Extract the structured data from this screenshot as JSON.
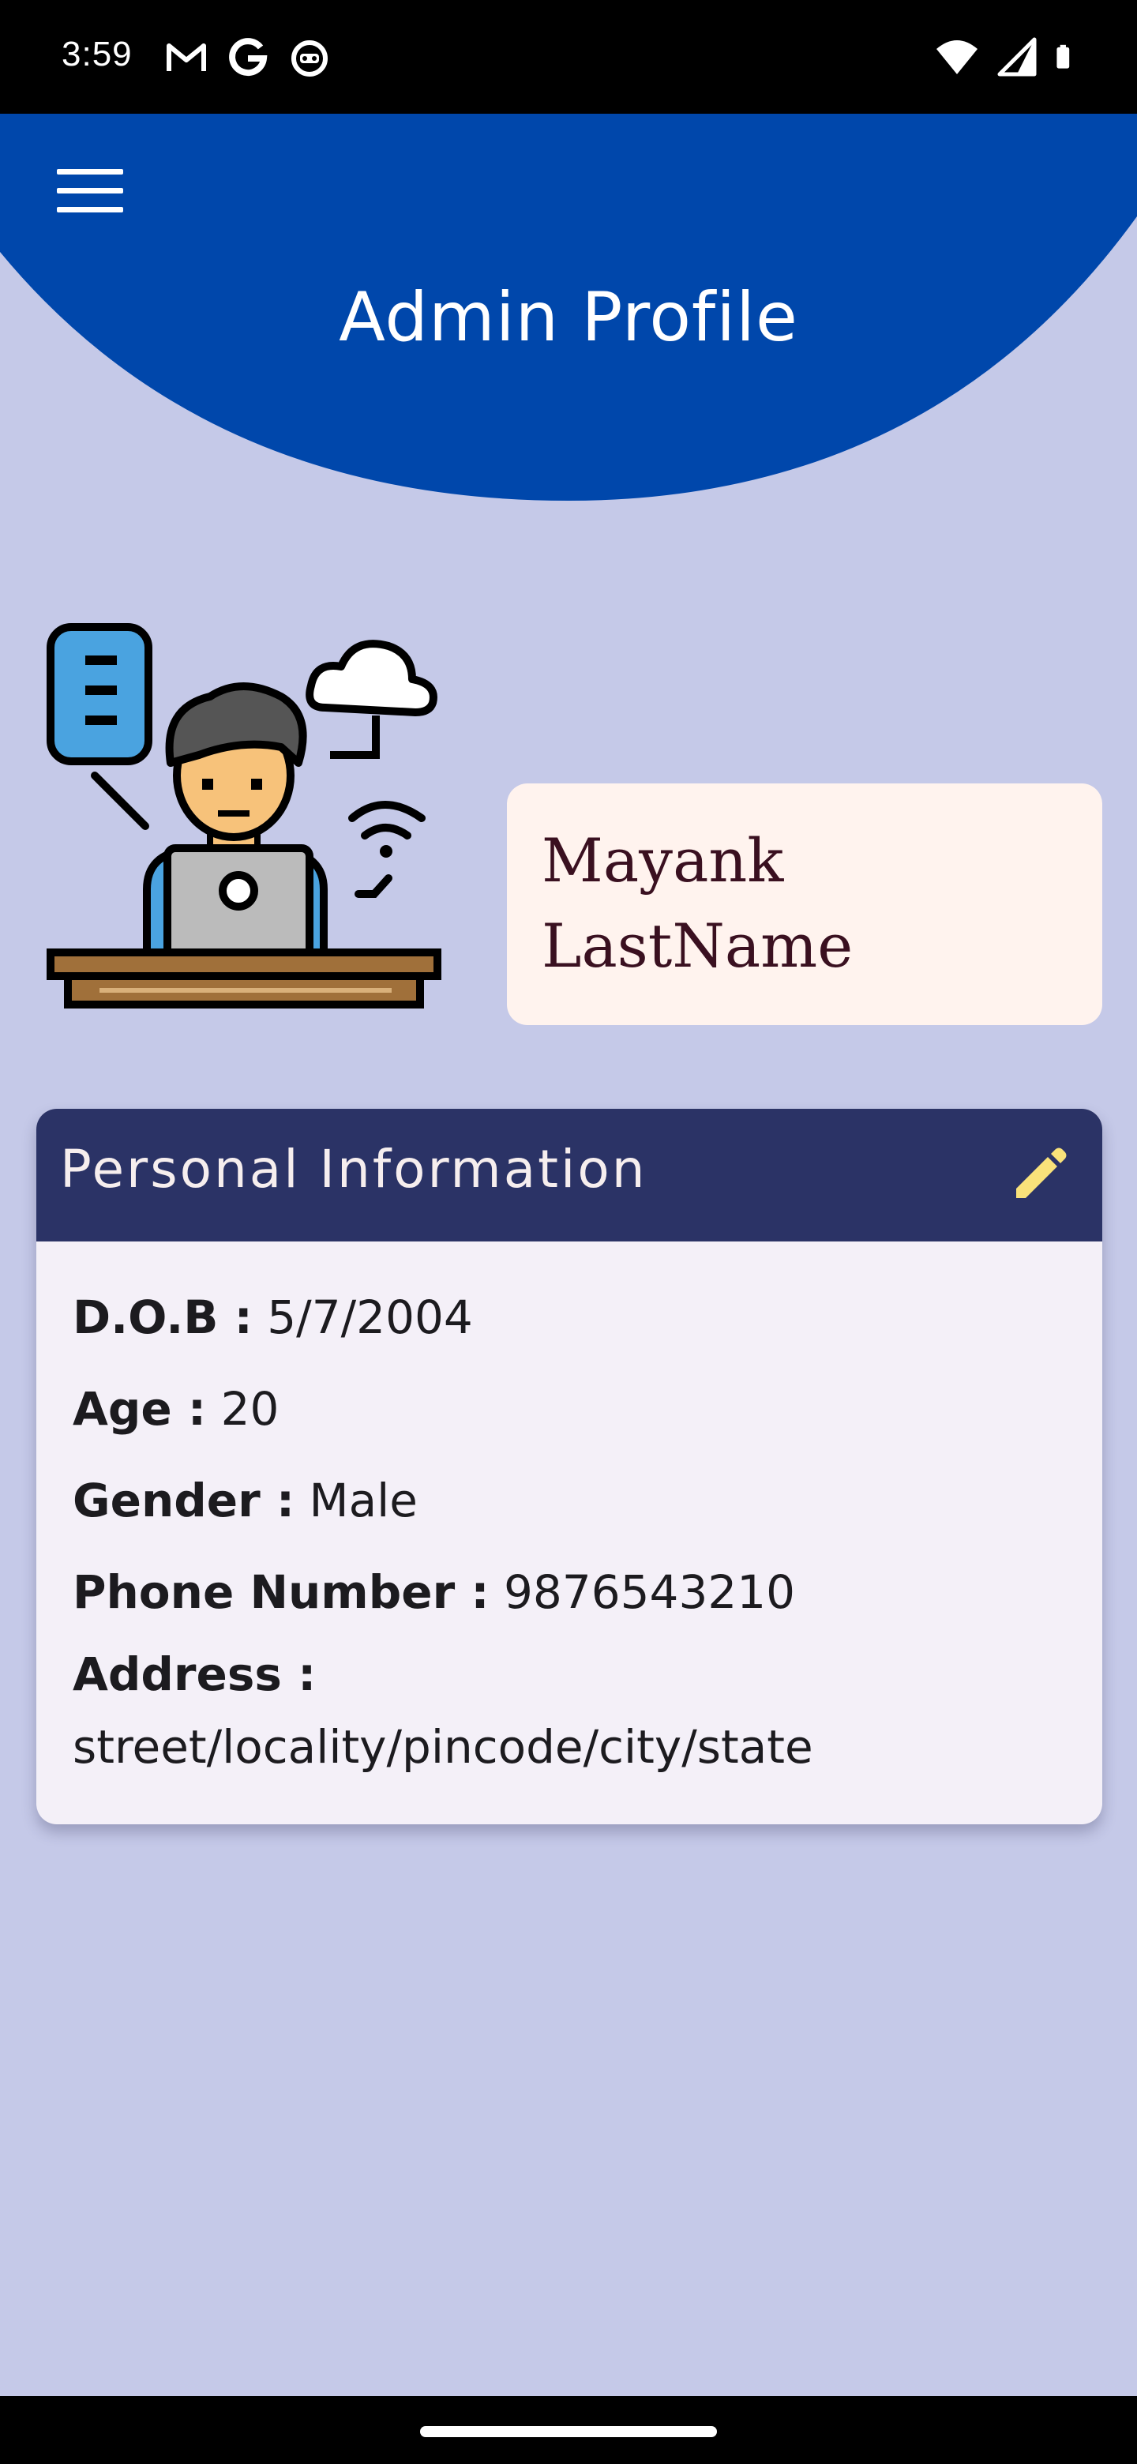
{
  "status_bar": {
    "time": "3:59",
    "left_icons": [
      "gmail-icon",
      "google-icon",
      "notification-bot-icon"
    ],
    "right_icons": [
      "wifi-icon",
      "cell-signal-icon",
      "battery-icon"
    ]
  },
  "header": {
    "title": "Admin Profile",
    "menu_icon": "hamburger-menu-icon",
    "color": "#0047ab"
  },
  "profile": {
    "avatar_icon": "admin-at-laptop-illustration",
    "first_name": "Mayank",
    "last_name": "LastName"
  },
  "personal_info": {
    "title": "Personal Information",
    "edit_icon": "edit-pencil-icon",
    "rows": [
      {
        "label": "D.O.B :",
        "value": "5/7/2004"
      },
      {
        "label": "Age :",
        "value": "20"
      },
      {
        "label": "Gender :",
        "value": "Male"
      },
      {
        "label": "Phone Number :",
        "value": "9876543210"
      }
    ],
    "address_label": "Address :",
    "address_value": "street/locality/pincode/city/state"
  },
  "colors": {
    "background": "#c5c9e8",
    "header_blue": "#0047ab",
    "card_header": "#2b3366",
    "name_card": "#fff3ee",
    "edit_icon": "#f9e27a"
  }
}
